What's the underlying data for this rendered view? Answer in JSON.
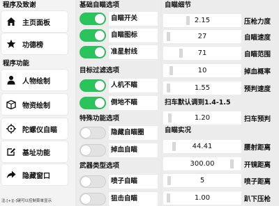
{
  "nav": {
    "settings_title": "程序及致谢",
    "features_title": "程序功能",
    "items": [
      {
        "label": "主页面板",
        "icon": "home-icon"
      },
      {
        "label": "功德榜",
        "icon": "star-icon"
      },
      {
        "label": "人物绘制",
        "icon": "person-icon"
      },
      {
        "label": "物资绘制",
        "icon": "box-icon"
      },
      {
        "label": "陀螺仪自瞄",
        "icon": "crosshair-icon"
      },
      {
        "label": "基址功能",
        "icon": "edit-icon"
      },
      {
        "label": "隐藏窗口",
        "icon": "share-arrow-icon"
      }
    ],
    "footnote": "注:[+][-]键可以控制菜单显示"
  },
  "aim": {
    "basic_title": "基础自瞄选项",
    "basic": [
      {
        "label": "自瞄开关",
        "on": true
      },
      {
        "label": "自瞄图标",
        "on": true
      },
      {
        "label": "准星射线",
        "on": true
      }
    ],
    "filter_title": "目标过滤选项",
    "filter": [
      {
        "label": "人机不瞄",
        "on": true
      },
      {
        "label": "倒地不瞄",
        "on": true
      }
    ],
    "special_title": "特殊功能选项",
    "special": [
      {
        "label": "隐藏自瞄圈",
        "on": false
      },
      {
        "label": "掉血自瞄",
        "on": false
      }
    ],
    "weapon_title": "武器类型选项",
    "weapon": [
      {
        "label": "喷子自瞄",
        "on": false
      },
      {
        "label": "狙击自瞄",
        "on": false
      }
    ]
  },
  "details": {
    "title": "自瞄细节",
    "sliders": [
      {
        "value": "2.15",
        "label": "压枪力度",
        "level": 0.3
      },
      {
        "value": "27",
        "label": "自瞄速度",
        "level": 0.02
      },
      {
        "value": "71",
        "label": "自瞄范围",
        "level": 0.2
      },
      {
        "value": "10",
        "label": "掉血概率",
        "level": 0.06
      },
      {
        "value": "1.55",
        "label": "预判速度",
        "level": 0.02
      }
    ],
    "vehicle_note": "扫车默认调到1.4-1.5",
    "vehicle_sliders": [
      {
        "value": "1.20",
        "label": "扫车预判",
        "level": 0.04
      }
    ],
    "realtime_title": "自瞄实况",
    "realtime_sliders": [
      {
        "value": "44.41",
        "label": "腰射距离",
        "level": 0.1
      },
      {
        "value": "300.00",
        "label": "开镜距离",
        "level": 0.92
      },
      {
        "value": "5",
        "label": "喷子距离",
        "level": 0.03
      },
      {
        "value": "1.00",
        "label": "趴下压枪",
        "level": 0.02
      }
    ]
  },
  "colors": {
    "toggle_on": "#2bc35c",
    "toggle_off": "#e2e2e2"
  }
}
